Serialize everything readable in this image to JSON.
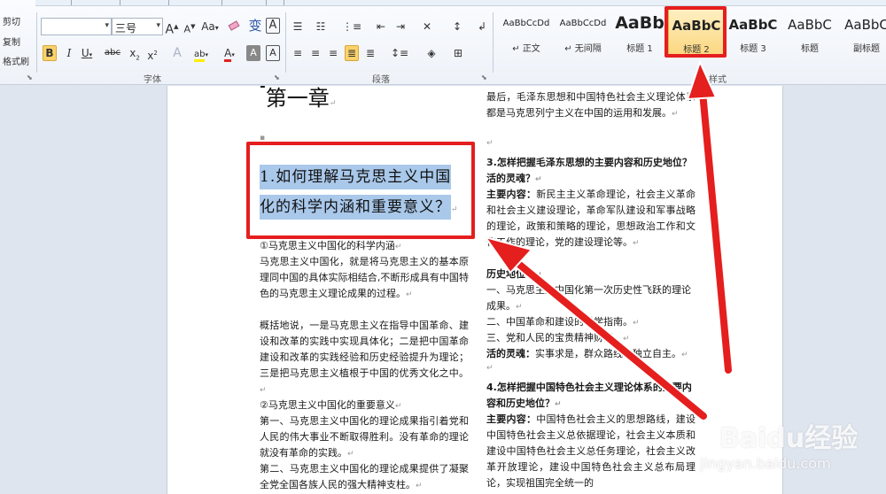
{
  "clipboard": {
    "cut": "剪切",
    "copy": "复制",
    "format_painter": "格式刷"
  },
  "font": {
    "name_value": "",
    "size_value": "三号",
    "grow_label": "A",
    "shrink_label": "A",
    "change_case_label": "Aa",
    "clear_format_label": "",
    "phonetic_label": "变",
    "border_label": "A",
    "bold_label": "B",
    "italic_label": "I",
    "underline_label": "U",
    "strike_label": "abc",
    "subscript_label": "x",
    "superscript_label": "x",
    "text_effect_label": "A",
    "highlight_label": "ab",
    "font_color_label": "A",
    "shading_label": "A",
    "char_border_label": "A",
    "group_label": "字体"
  },
  "paragraph": {
    "group_label": "段落"
  },
  "styles": {
    "group_label": "样式",
    "items": [
      {
        "sample": "AaBbCcDd",
        "name": "↵ 正文"
      },
      {
        "sample": "AaBbCcDd",
        "name": "↵ 无间隔"
      },
      {
        "sample": "AaBb",
        "name": "标题 1"
      },
      {
        "sample": "AaBbC",
        "name": "标题 2",
        "selected": true
      },
      {
        "sample": "AaBbC",
        "name": "标题 3"
      },
      {
        "sample": "AaBbC",
        "name": "标题"
      },
      {
        "sample": "AaBbC",
        "name": "副标题"
      }
    ]
  },
  "document": {
    "chapter": "第一章",
    "heading_line1": "1.如何理解马克思主义中国",
    "heading_line2": "化的科学内涵和重要意义？",
    "left": {
      "sub1": "①马克思主义中国化的科学内涵",
      "para1": "马克思主义中国化，就是将马克思主义的基本原理同中国的具体实际相结合,不断形成具有中国特色的马克思主义理论成果的过程。",
      "para2": "概括地说，一是马克思主义在指导中国革命、建设和改革的实践中实现具体化；二是把中国革命建设和改革的实践经验和历史经验提升为理论；三是把马克思主义植根于中国的优秀文化之中。",
      "sub2": "②马克思主义中国化的重要意义",
      "para3": "第一、马克思主义中国化的理论成果指引着党和人民的伟大事业不断取得胜利。没有革命的理论就没有革命的实践。",
      "para4": "第二、马克思主义中国化的理论成果提供了凝聚全党全国各族人民的强大精神支柱。"
    },
    "right": {
      "para0": "最后，毛泽东思想和中国特色社会主义理论体系都是马克思列宁主义在中国的运用和发展。",
      "q3": "3.怎样把握毛泽东思想的主要内容和历史地位？活的灵魂？",
      "content_label": "主要内容：",
      "content_text": "新民主主义革命理论，社会主义革命和社会主义建设理论，革命军队建设和军事战略的理论，政策和策略的理论，思想政治工作和文化工作的理论，党的建设理论等。",
      "hist_label": "历史地位：",
      "hist1": "一、马克思主义中国化第一次历史性飞跃的理论成果。",
      "hist2": "二、中国革命和建设的科学指南。",
      "hist3": "三、党和人民的宝贵精神财富。",
      "soul_label": "活的灵魂：",
      "soul_text": "实事求是，群众路线，独立自主。",
      "q4": "4.怎样把握中国特色社会主义理论体系的主要内容和历史地位？",
      "content2_label": "主要内容：",
      "content2_text": "中国特色社会主义的思想路线，建设中国特色社会主义总依据理论，社会主义本质和建设中国特色社会主义总任务理论，社会主义改革开放理论，建设中国特色社会主义总布局理论，实现祖国完全统一的"
    }
  },
  "watermark": {
    "brand": "Baidu经验",
    "url": "jingyan.baidu.com"
  }
}
